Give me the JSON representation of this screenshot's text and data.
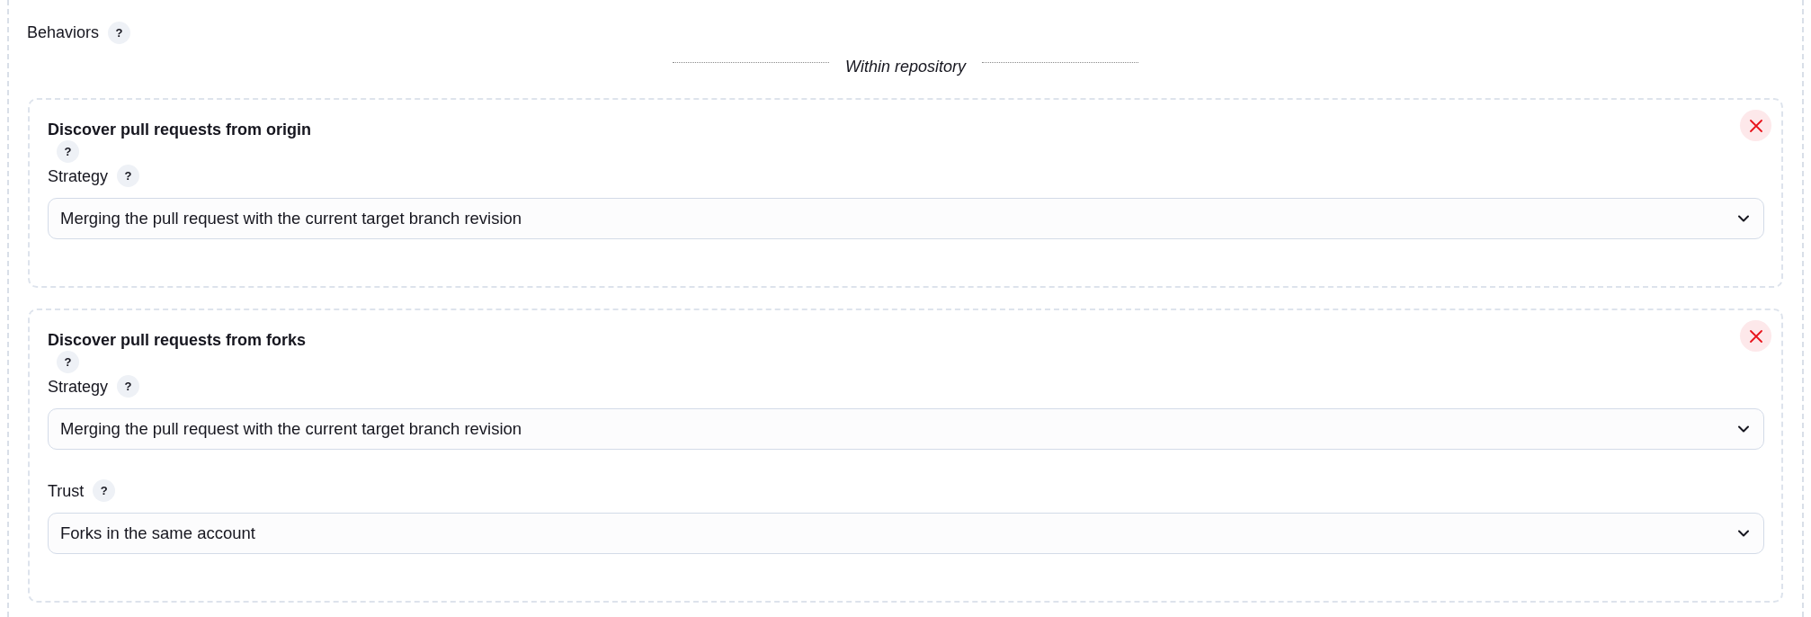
{
  "section": {
    "title": "Behaviors",
    "help": "?"
  },
  "group_heading": "Within repository",
  "behaviors": [
    {
      "title": "Discover pull requests from origin",
      "help": "?",
      "fields": [
        {
          "label": "Strategy",
          "help": "?",
          "value": "Merging the pull request with the current target branch revision"
        }
      ]
    },
    {
      "title": "Discover pull requests from forks",
      "help": "?",
      "fields": [
        {
          "label": "Strategy",
          "help": "?",
          "value": "Merging the pull request with the current target branch revision"
        },
        {
          "label": "Trust",
          "help": "?",
          "value": "Forks in the same account"
        }
      ]
    }
  ]
}
